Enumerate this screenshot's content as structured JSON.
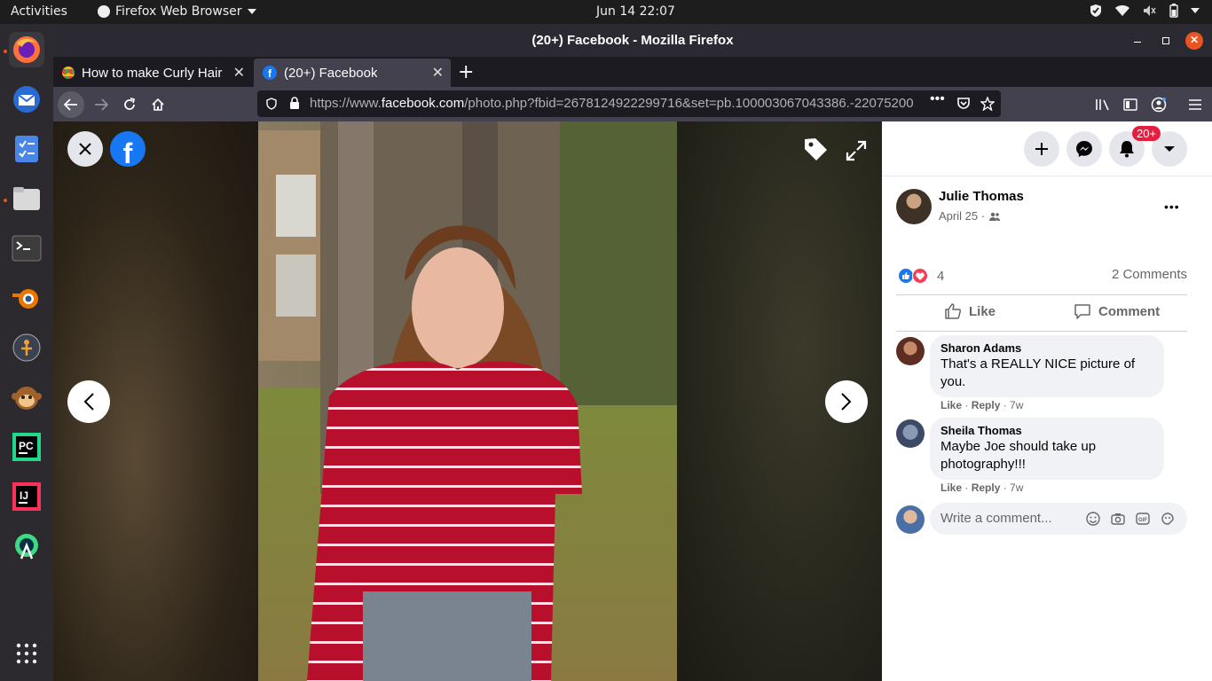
{
  "topbar": {
    "activities": "Activities",
    "app_menu": "Firefox Web Browser",
    "clock": "Jun 14  22:07"
  },
  "window": {
    "title": "(20+) Facebook - Mozilla Firefox"
  },
  "tabs": [
    {
      "label": "How to make Curly Hair F",
      "active": false
    },
    {
      "label": "(20+) Facebook",
      "active": true
    }
  ],
  "urlbar": {
    "prefix": "https://www.",
    "domain": "facebook.com",
    "path": "/photo.php?fbid=2678124922299716&set=pb.100003067043386.-22075200"
  },
  "fb_header": {
    "notifications_badge": "20+"
  },
  "post": {
    "author": "Julie Thomas",
    "date": "April 25 ·",
    "reactions_count": "4",
    "comments_count": "2 Comments",
    "like_label": "Like",
    "comment_label": "Comment"
  },
  "comments": [
    {
      "author": "Sharon Adams",
      "text": "That's a REALLY NICE picture of you.",
      "like": "Like",
      "reply": "Reply",
      "age": "7w"
    },
    {
      "author": "Sheila Thomas",
      "text": "Maybe Joe should take up photography!!!",
      "like": "Like",
      "reply": "Reply",
      "age": "7w"
    }
  ],
  "composer": {
    "placeholder": "Write a comment..."
  },
  "colors": {
    "accent_orange": "#e95420",
    "facebook_blue": "#1877f2",
    "badge_red": "#e41e3f"
  }
}
